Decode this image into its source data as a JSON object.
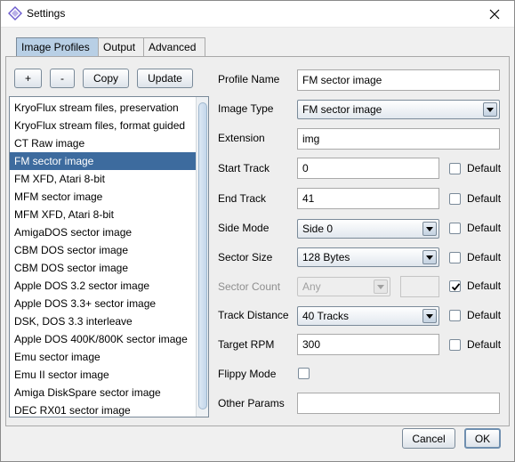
{
  "window": {
    "title": "Settings"
  },
  "tabs": [
    "Image Profiles",
    "Output",
    "Advanced"
  ],
  "toolbar": {
    "add": "+",
    "remove": "-",
    "copy": "Copy",
    "update": "Update"
  },
  "profiles": [
    "KryoFlux stream files, preservation",
    "KryoFlux stream files, format guided",
    "CT Raw image",
    "FM sector image",
    "FM XFD, Atari 8-bit",
    "MFM sector image",
    "MFM XFD, Atari 8-bit",
    "AmigaDOS sector image",
    "CBM DOS sector image",
    "CBM DOS sector image",
    "Apple DOS 3.2 sector image",
    "Apple DOS 3.3+ sector image",
    "DSK, DOS 3.3 interleave",
    "Apple DOS 400K/800K sector image",
    "Emu sector image",
    "Emu II sector image",
    "Amiga DiskSpare sector image",
    "DEC RX01 sector image"
  ],
  "selected_profile": "FM sector image",
  "form": {
    "profile_name": {
      "label": "Profile Name",
      "value": "FM sector image"
    },
    "image_type": {
      "label": "Image Type",
      "value": "FM sector image"
    },
    "extension": {
      "label": "Extension",
      "value": "img"
    },
    "start_track": {
      "label": "Start Track",
      "value": "0",
      "default_label": "Default",
      "default_checked": false
    },
    "end_track": {
      "label": "End Track",
      "value": "41",
      "default_label": "Default",
      "default_checked": false
    },
    "side_mode": {
      "label": "Side Mode",
      "value": "Side 0",
      "default_label": "Default",
      "default_checked": false
    },
    "sector_size": {
      "label": "Sector Size",
      "value": "128 Bytes",
      "default_label": "Default",
      "default_checked": false
    },
    "sector_count": {
      "label": "Sector Count",
      "value": "Any",
      "default_label": "Default",
      "default_checked": true
    },
    "track_distance": {
      "label": "Track Distance",
      "value": "40 Tracks",
      "default_label": "Default",
      "default_checked": false
    },
    "target_rpm": {
      "label": "Target RPM",
      "value": "300",
      "default_label": "Default",
      "default_checked": false
    },
    "flippy_mode": {
      "label": "Flippy Mode",
      "checked": false
    },
    "other_params": {
      "label": "Other Params",
      "value": ""
    }
  },
  "footer": {
    "cancel": "Cancel",
    "ok": "OK"
  },
  "colors": {
    "selection": "#3d6b9e",
    "active_tab": "#b8cfe5",
    "panel": "#eeeeee"
  }
}
